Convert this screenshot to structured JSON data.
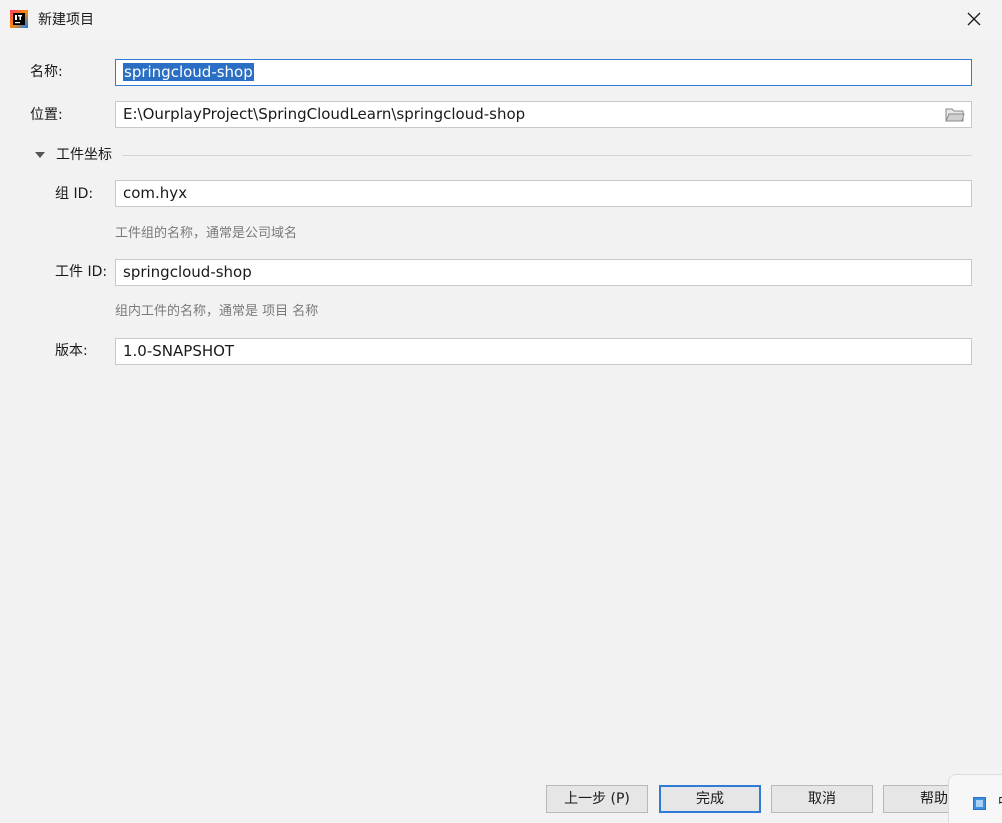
{
  "window": {
    "title": "新建项目"
  },
  "form": {
    "name_label": "名称:",
    "name_value": "springcloud-shop",
    "location_label": "位置:",
    "location_value": "E:\\OurplayProject\\SpringCloudLearn\\springcloud-shop",
    "section_title": "工件坐标",
    "group_label": "组 ID:",
    "group_value": "com.hyx",
    "group_hint": "工件组的名称，通常是公司域名",
    "artifact_label": "工件 ID:",
    "artifact_value": "springcloud-shop",
    "artifact_hint": "组内工件的名称，通常是 项目 名称",
    "version_label": "版本:",
    "version_value": "1.0-SNAPSHOT"
  },
  "buttons": {
    "previous": "上一步 (P)",
    "finish": "完成",
    "cancel": "取消",
    "help": "帮助"
  },
  "popup": {
    "text": "中"
  },
  "colors": {
    "selection": "#2a6fc4",
    "focus_border": "#2f7bd6"
  }
}
